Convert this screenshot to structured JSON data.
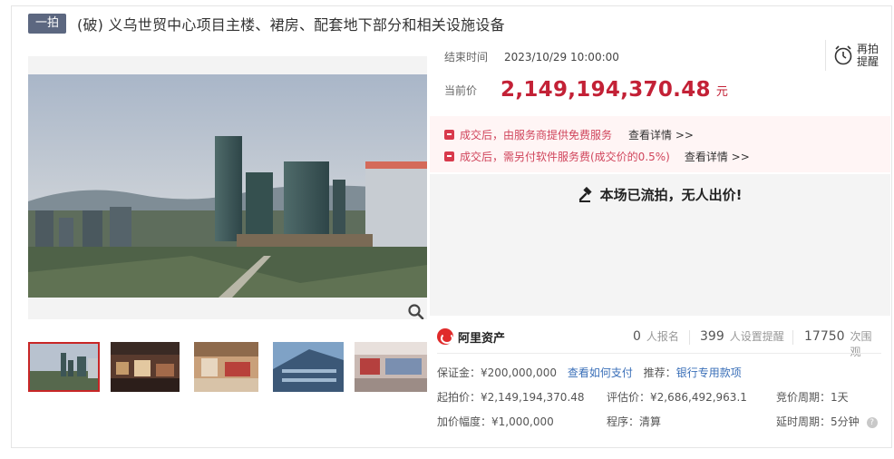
{
  "header": {
    "badge": "一拍",
    "title": "(破) 义乌世贸中心项目主楼、裙房、配套地下部分和相关设施设备"
  },
  "auction": {
    "end_label": "结束时间",
    "end_time": "2023/10/29 10:00:00",
    "price_label": "当前价",
    "price": "2,149,194,370.48",
    "currency": "元",
    "remind_label": "再拍提醒",
    "status": "本场已流拍，无人出价!"
  },
  "notices": [
    {
      "text": "成交后，由服务商提供免费服务",
      "link": "查看详情 >>"
    },
    {
      "text": "成交后，需另付软件服务费(成交价的0.5%)",
      "link": "查看详情 >>"
    }
  ],
  "platform": {
    "name": "阿里资产",
    "signups": "0",
    "signups_unit": "人报名",
    "reminders": "399",
    "reminders_unit": "人设置提醒",
    "views": "17750",
    "views_unit": "次围观"
  },
  "details": {
    "deposit_label": "保证金：",
    "deposit": "¥200,000,000",
    "deposit_link": "查看如何支付",
    "recommend_label": "推荐：",
    "recommend_link": "银行专用款项",
    "start_label": "起拍价：",
    "start_price": "¥2,149,194,370.48",
    "appraisal_label": "评估价：",
    "appraisal": "¥2,686,492,963.1",
    "cycle_label": "竞价周期：",
    "cycle": "1天",
    "increment_label": "加价幅度：",
    "increment": "¥1,000,000",
    "procedure_label": "程序：",
    "procedure": "清算",
    "delay_label": "延时周期：",
    "delay": "5分钟"
  },
  "colors": {
    "price_red": "#c32136",
    "badge_bg": "#5c6780",
    "link_blue": "#3a6fb8"
  }
}
